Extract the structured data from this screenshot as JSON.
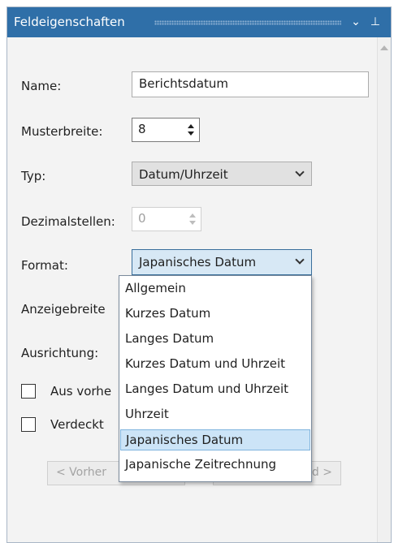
{
  "window": {
    "title": "Feldeigenschaften",
    "dropdown_button_icon": "chevron-down-icon",
    "pin_icon": "pin-icon"
  },
  "fields": {
    "name_label": "Name:",
    "name_value": "Berichtsdatum",
    "musterbreite_label": "Musterbreite:",
    "musterbreite_value": "8",
    "typ_label": "Typ:",
    "typ_value": "Datum/Uhrzeit",
    "dezimal_label": "Dezimalstellen:",
    "dezimal_value": "0",
    "format_label": "Format:",
    "format_value": "Japanisches Datum",
    "anzeigebreite_label": "Anzeigebreite",
    "ausrichtung_label": "Ausrichtung:",
    "aus_vorher_label": "Aus vorhe",
    "verdeckt_label": "Verdeckt"
  },
  "nav": {
    "prev_label": "< Vorher",
    "next_label": "d >"
  },
  "format_dropdown": {
    "selected": "Japanisches Datum",
    "options": [
      "Allgemein",
      "Kurzes Datum",
      "Langes Datum",
      "Kurzes Datum und Uhrzeit",
      "Langes Datum und Uhrzeit",
      "Uhrzeit",
      "Japanisches Datum",
      "Japanische Zeitrechnung"
    ]
  },
  "colors": {
    "titlebar": "#2f6fa8",
    "selection": "#cce4f7"
  }
}
